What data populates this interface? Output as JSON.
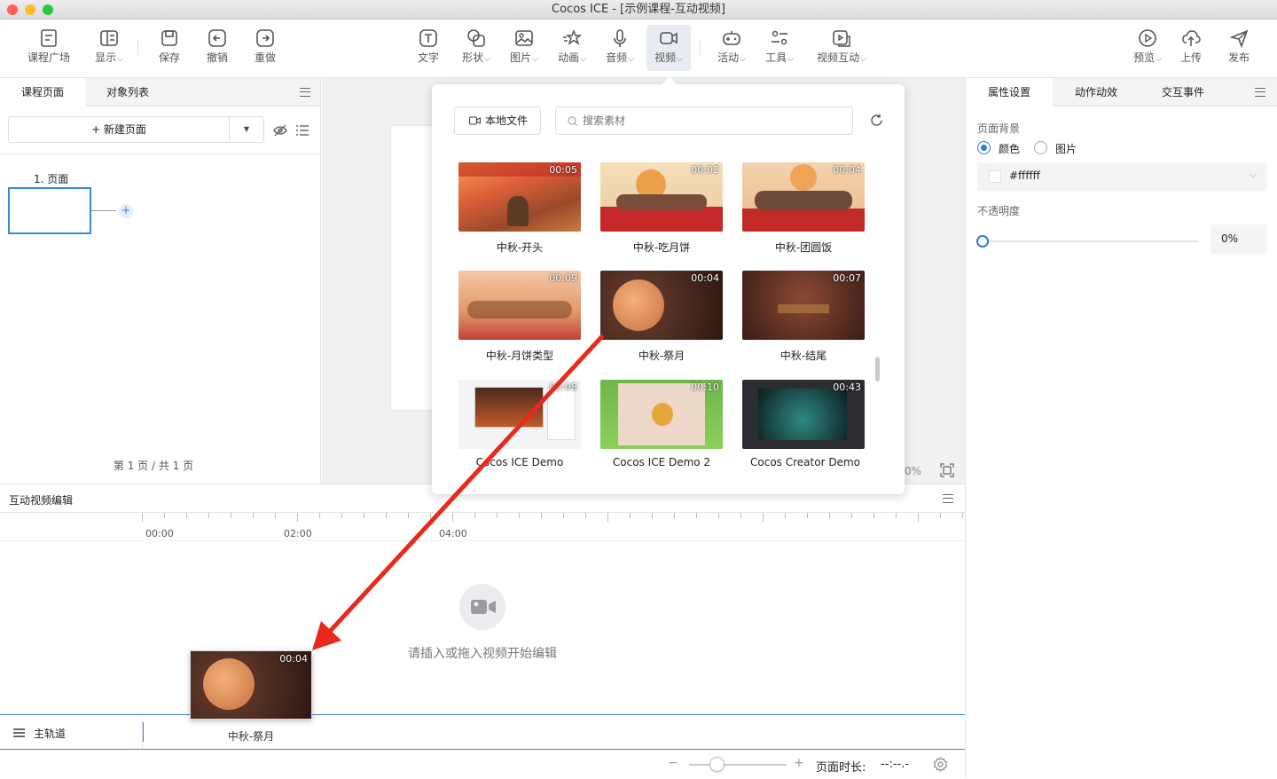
{
  "window": {
    "title": "Cocos ICE - [示例课程-互动视频]"
  },
  "toolbar": {
    "left": [
      {
        "label": "课程广场",
        "icon": "course-square-icon"
      },
      {
        "label": "显示",
        "icon": "display-icon",
        "dropdown": true
      },
      {
        "label": "保存",
        "icon": "save-icon"
      },
      {
        "label": "撤销",
        "icon": "undo-icon"
      },
      {
        "label": "重做",
        "icon": "redo-icon"
      }
    ],
    "center": [
      {
        "label": "文字",
        "icon": "text-icon"
      },
      {
        "label": "形状",
        "icon": "shape-icon",
        "dropdown": true
      },
      {
        "label": "图片",
        "icon": "image-icon",
        "dropdown": true
      },
      {
        "label": "动画",
        "icon": "animation-icon",
        "dropdown": true
      },
      {
        "label": "音频",
        "icon": "microphone-icon",
        "dropdown": true
      },
      {
        "label": "视频",
        "icon": "video-icon",
        "dropdown": true,
        "active": true
      },
      {
        "label": "活动",
        "icon": "gamepad-icon",
        "dropdown": true
      },
      {
        "label": "工具",
        "icon": "tools-icon",
        "dropdown": true
      },
      {
        "label": "视频互动",
        "icon": "video-interact-icon",
        "dropdown": true
      }
    ],
    "right": [
      {
        "label": "预览",
        "icon": "play-icon",
        "dropdown": true
      },
      {
        "label": "上传",
        "icon": "upload-icon"
      },
      {
        "label": "发布",
        "icon": "send-icon"
      }
    ]
  },
  "left_panel": {
    "tabs": [
      "课程页面",
      "对象列表"
    ],
    "new_page": "+ 新建页面",
    "pages": [
      {
        "label": "1. 页面"
      }
    ],
    "pagination": "第 1 页 / 共 1 页"
  },
  "popup": {
    "local_file": "本地文件",
    "search_placeholder": "搜索素材",
    "items": [
      {
        "name": "中秋-开头",
        "duration": "00:05"
      },
      {
        "name": "中秋-吃月饼",
        "duration": "00:02"
      },
      {
        "name": "中秋-团圆饭",
        "duration": "00:04"
      },
      {
        "name": "中秋-月饼类型",
        "duration": "00:09"
      },
      {
        "name": "中秋-祭月",
        "duration": "00:04"
      },
      {
        "name": "中秋-结尾",
        "duration": "00:07"
      },
      {
        "name": "Cocos ICE Demo",
        "duration": "00:08"
      },
      {
        "name": "Cocos ICE Demo 2",
        "duration": "00:10"
      },
      {
        "name": "Cocos Creator Demo",
        "duration": "00:43"
      }
    ]
  },
  "canvas": {
    "zoom_partial": "0%"
  },
  "right_panel": {
    "tabs": [
      "属性设置",
      "动作动效",
      "交互事件"
    ],
    "bg_label": "页面背景",
    "bg_options": [
      "颜色",
      "图片"
    ],
    "bg_selected": "颜色",
    "color_value": "#ffffff",
    "opacity_label": "不透明度",
    "opacity_value": "0%"
  },
  "timeline": {
    "title": "互动视频编辑",
    "ticks": [
      "00:00",
      "02:00",
      "04:00"
    ],
    "empty_hint": "请插入或拖入视频开始编辑",
    "track_label": "主轨道",
    "page_duration_label": "页面时长:",
    "page_duration_value": "--:--.-",
    "drag_item": {
      "name": "中秋-祭月",
      "duration": "00:04"
    }
  },
  "colors": {
    "accent": "#2f7bd8",
    "arrow": "#e8291c"
  }
}
